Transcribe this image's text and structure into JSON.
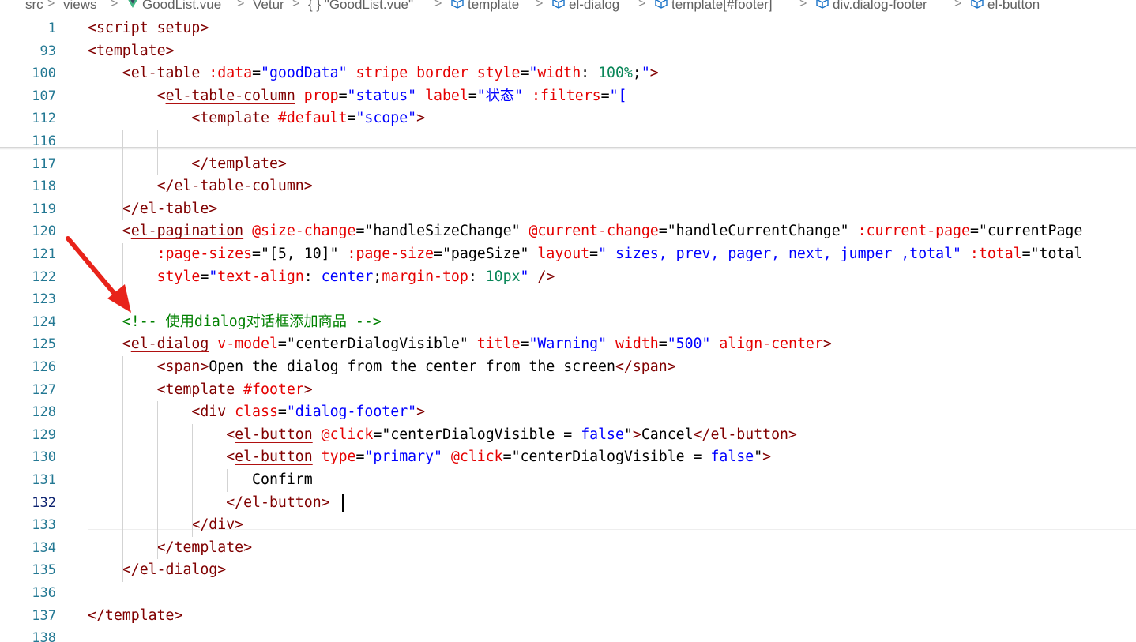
{
  "breadcrumb": [
    {
      "label": "src",
      "icon": null
    },
    {
      "label": "views",
      "icon": null
    },
    {
      "label": "GoodList.vue",
      "icon": "vue-icon"
    },
    {
      "label": "Vetur",
      "icon": null
    },
    {
      "label": "{ } \"GoodList.vue\"",
      "icon": null
    },
    {
      "label": "template",
      "icon": "cube-icon"
    },
    {
      "label": "el-dialog",
      "icon": "cube-icon"
    },
    {
      "label": "template[#footer]",
      "icon": "cube-icon"
    },
    {
      "label": "div.dialog-footer",
      "icon": "cube-icon"
    },
    {
      "label": "el-button",
      "icon": "cube-icon"
    }
  ],
  "separator": ">",
  "active_line": "132",
  "lines": [
    {
      "num": "1",
      "tokens": [
        {
          "t": "<script setup>",
          "c": "t"
        }
      ]
    },
    {
      "num": "93",
      "tokens": [
        {
          "t": "<template>",
          "c": "t"
        }
      ]
    },
    {
      "num": "100",
      "tokens": [
        {
          "t": "    <",
          "c": "t"
        },
        {
          "t": "el-table",
          "c": "t u"
        },
        {
          "t": " ",
          "c": "p"
        },
        {
          "t": ":data",
          "c": "a"
        },
        {
          "t": "=",
          "c": "p"
        },
        {
          "t": "\"goodData\"",
          "c": "v"
        },
        {
          "t": " stripe border style",
          "c": "a"
        },
        {
          "t": "=",
          "c": "p"
        },
        {
          "t": "\"",
          "c": "v"
        },
        {
          "t": "width",
          "c": "a"
        },
        {
          "t": ": ",
          "c": "p"
        },
        {
          "t": "100%",
          "c": "n"
        },
        {
          "t": ";",
          "c": "p"
        },
        {
          "t": "\"",
          "c": "v"
        },
        {
          "t": ">",
          "c": "t"
        }
      ]
    },
    {
      "num": "107",
      "tokens": [
        {
          "t": "        <",
          "c": "t"
        },
        {
          "t": "el-table-column",
          "c": "t u"
        },
        {
          "t": " prop",
          "c": "a"
        },
        {
          "t": "=",
          "c": "p"
        },
        {
          "t": "\"status\"",
          "c": "v"
        },
        {
          "t": " label",
          "c": "a"
        },
        {
          "t": "=",
          "c": "p"
        },
        {
          "t": "\"状态\"",
          "c": "v"
        },
        {
          "t": " :filters",
          "c": "a"
        },
        {
          "t": "=",
          "c": "p"
        },
        {
          "t": "\"[",
          "c": "v"
        }
      ]
    },
    {
      "num": "112",
      "tokens": [
        {
          "t": "            <template ",
          "c": "t"
        },
        {
          "t": "#default",
          "c": "a"
        },
        {
          "t": "=",
          "c": "p"
        },
        {
          "t": "\"scope\"",
          "c": "v"
        },
        {
          "t": ">",
          "c": "t"
        }
      ]
    },
    {
      "num": "116",
      "tokens": []
    },
    {
      "num": "117",
      "tokens": [
        {
          "t": "            </template>",
          "c": "t"
        }
      ]
    },
    {
      "num": "118",
      "tokens": [
        {
          "t": "        </el-table-column>",
          "c": "t"
        }
      ]
    },
    {
      "num": "119",
      "tokens": [
        {
          "t": "    </el-table>",
          "c": "t"
        }
      ]
    },
    {
      "num": "120",
      "tokens": [
        {
          "t": "    <",
          "c": "t"
        },
        {
          "t": "el-pagination",
          "c": "t u"
        },
        {
          "t": " ",
          "c": "p"
        },
        {
          "t": "@size-change",
          "c": "a"
        },
        {
          "t": "=",
          "c": "p"
        },
        {
          "t": "\"handleSizeChange\"",
          "c": "p"
        },
        {
          "t": " @current-change",
          "c": "a"
        },
        {
          "t": "=",
          "c": "p"
        },
        {
          "t": "\"handleCurrentChange\"",
          "c": "p"
        },
        {
          "t": " :current-page",
          "c": "a"
        },
        {
          "t": "=",
          "c": "p"
        },
        {
          "t": "\"currentPage",
          "c": "p"
        }
      ]
    },
    {
      "num": "121",
      "tokens": [
        {
          "t": "        :page-sizes",
          "c": "a"
        },
        {
          "t": "=",
          "c": "p"
        },
        {
          "t": "\"[5, 10]\"",
          "c": "p"
        },
        {
          "t": " :page-size",
          "c": "a"
        },
        {
          "t": "=",
          "c": "p"
        },
        {
          "t": "\"pageSize\"",
          "c": "p"
        },
        {
          "t": " layout",
          "c": "a"
        },
        {
          "t": "=",
          "c": "p"
        },
        {
          "t": "\" sizes, prev, pager, next, jumper ,total\"",
          "c": "v"
        },
        {
          "t": " :total",
          "c": "a"
        },
        {
          "t": "=",
          "c": "p"
        },
        {
          "t": "\"total",
          "c": "p"
        }
      ]
    },
    {
      "num": "122",
      "tokens": [
        {
          "t": "        style",
          "c": "a"
        },
        {
          "t": "=",
          "c": "p"
        },
        {
          "t": "\"",
          "c": "v"
        },
        {
          "t": "text-align",
          "c": "a"
        },
        {
          "t": ": ",
          "c": "p"
        },
        {
          "t": "center",
          "c": "v"
        },
        {
          "t": ";",
          "c": "p"
        },
        {
          "t": "margin-top",
          "c": "a"
        },
        {
          "t": ": ",
          "c": "p"
        },
        {
          "t": "10px",
          "c": "n"
        },
        {
          "t": "\"",
          "c": "v"
        },
        {
          "t": " />",
          "c": "t"
        }
      ]
    },
    {
      "num": "123",
      "tokens": []
    },
    {
      "num": "124",
      "tokens": [
        {
          "t": "    <!-- 使用dialog对话框添加商品 -->",
          "c": "c"
        }
      ]
    },
    {
      "num": "125",
      "tokens": [
        {
          "t": "    <",
          "c": "t"
        },
        {
          "t": "el-dialog",
          "c": "t u"
        },
        {
          "t": " v-model",
          "c": "a"
        },
        {
          "t": "=",
          "c": "p"
        },
        {
          "t": "\"centerDialogVisible\"",
          "c": "p"
        },
        {
          "t": " title",
          "c": "a"
        },
        {
          "t": "=",
          "c": "p"
        },
        {
          "t": "\"Warning\"",
          "c": "v"
        },
        {
          "t": " width",
          "c": "a"
        },
        {
          "t": "=",
          "c": "p"
        },
        {
          "t": "\"500\"",
          "c": "v"
        },
        {
          "t": " align-center",
          "c": "a"
        },
        {
          "t": ">",
          "c": "t"
        }
      ]
    },
    {
      "num": "126",
      "tokens": [
        {
          "t": "        <span>",
          "c": "t"
        },
        {
          "t": "Open the dialog from the center from the screen",
          "c": "p"
        },
        {
          "t": "</span>",
          "c": "t"
        }
      ]
    },
    {
      "num": "127",
      "tokens": [
        {
          "t": "        <template ",
          "c": "t"
        },
        {
          "t": "#footer",
          "c": "a"
        },
        {
          "t": ">",
          "c": "t"
        }
      ]
    },
    {
      "num": "128",
      "tokens": [
        {
          "t": "            <div ",
          "c": "t"
        },
        {
          "t": "class",
          "c": "a"
        },
        {
          "t": "=",
          "c": "p"
        },
        {
          "t": "\"dialog-footer\"",
          "c": "v"
        },
        {
          "t": ">",
          "c": "t"
        }
      ]
    },
    {
      "num": "129",
      "tokens": [
        {
          "t": "                <",
          "c": "t"
        },
        {
          "t": "el-button",
          "c": "t u"
        },
        {
          "t": " ",
          "c": "p"
        },
        {
          "t": "@click",
          "c": "a"
        },
        {
          "t": "=",
          "c": "p"
        },
        {
          "t": "\"centerDialogVisible = ",
          "c": "p"
        },
        {
          "t": "false",
          "c": "v"
        },
        {
          "t": "\"",
          "c": "p"
        },
        {
          "t": ">",
          "c": "t"
        },
        {
          "t": "Cancel",
          "c": "p"
        },
        {
          "t": "</el-button>",
          "c": "t"
        }
      ]
    },
    {
      "num": "130",
      "tokens": [
        {
          "t": "                <",
          "c": "t"
        },
        {
          "t": "el-button",
          "c": "t u"
        },
        {
          "t": " type",
          "c": "a"
        },
        {
          "t": "=",
          "c": "p"
        },
        {
          "t": "\"primary\"",
          "c": "v"
        },
        {
          "t": " @click",
          "c": "a"
        },
        {
          "t": "=",
          "c": "p"
        },
        {
          "t": "\"centerDialogVisible = ",
          "c": "p"
        },
        {
          "t": "false",
          "c": "v"
        },
        {
          "t": "\"",
          "c": "p"
        },
        {
          "t": ">",
          "c": "t"
        }
      ]
    },
    {
      "num": "131",
      "tokens": [
        {
          "t": "                   Confirm",
          "c": "p"
        }
      ]
    },
    {
      "num": "132",
      "tokens": [
        {
          "t": "                </el-button>",
          "c": "t"
        }
      ]
    },
    {
      "num": "133",
      "tokens": [
        {
          "t": "            </div>",
          "c": "t"
        }
      ]
    },
    {
      "num": "134",
      "tokens": [
        {
          "t": "        </template>",
          "c": "t"
        }
      ]
    },
    {
      "num": "135",
      "tokens": [
        {
          "t": "    </el-dialog>",
          "c": "t"
        }
      ]
    },
    {
      "num": "136",
      "tokens": []
    },
    {
      "num": "137",
      "tokens": [
        {
          "t": "</template>",
          "c": "t"
        }
      ]
    },
    {
      "num": "138",
      "tokens": []
    }
  ],
  "colors": {
    "tag": "#800000",
    "attr": "#e50000",
    "value": "#0000ff",
    "comment": "#008000",
    "number": "#098658",
    "line_number": "#237893",
    "annotation_arrow": "#e8231a"
  }
}
